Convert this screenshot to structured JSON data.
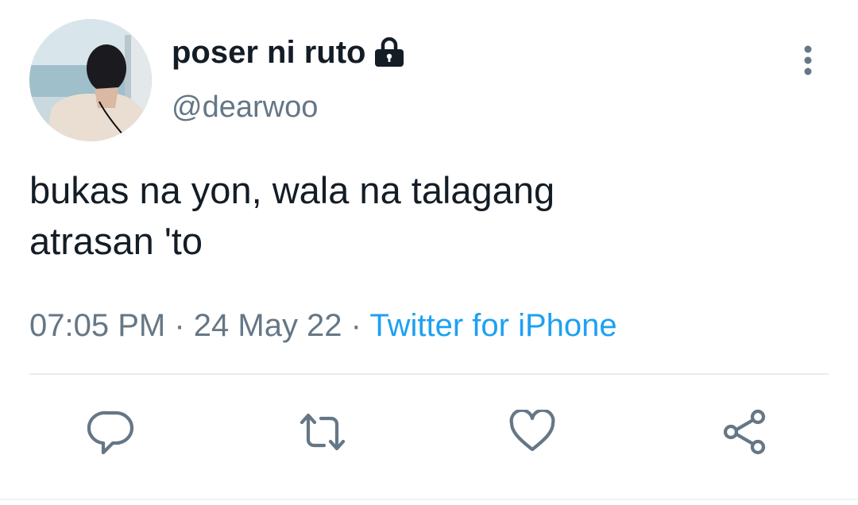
{
  "tweet": {
    "author": {
      "display_name": "poser ni ruto",
      "handle": "@dearwoo",
      "avatar": "profile-photo",
      "protected_icon": "lock-icon"
    },
    "text_line_1": "bukas na yon, wala na talagang",
    "text_line_2": "atrasan 'to",
    "time": "07:05 PM",
    "separator": " · ",
    "date": "24 May 22",
    "source": "Twitter for iPhone"
  },
  "actions": [
    {
      "name": "reply",
      "icon": "comment-icon"
    },
    {
      "name": "retweet",
      "icon": "retweet-icon"
    },
    {
      "name": "like",
      "icon": "heart-icon"
    },
    {
      "name": "share",
      "icon": "share-icon"
    }
  ],
  "colors": {
    "text": "#141d26",
    "secondary": "#657786",
    "link": "#1da1f2",
    "divider": "#e6ecf0"
  }
}
